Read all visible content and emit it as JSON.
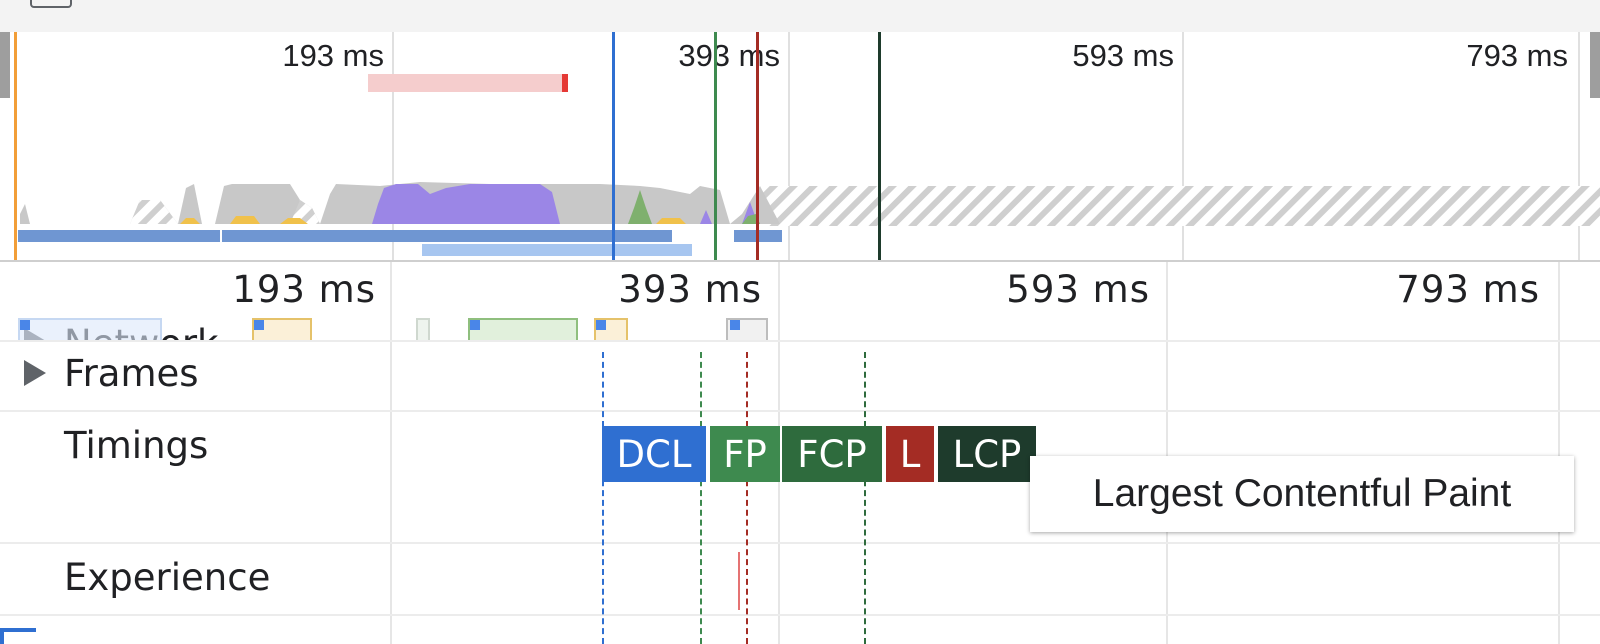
{
  "overview": {
    "ticks": [
      "193 ms",
      "393 ms",
      "593 ms",
      "793 ms"
    ]
  },
  "flamechart": {
    "ticks": [
      "193 ms",
      "393 ms",
      "593 ms",
      "793 ms"
    ],
    "tracks": {
      "network": "Network",
      "frames": "Frames",
      "timings": "Timings",
      "experience": "Experience"
    },
    "markers": {
      "dcl": "DCL",
      "fp": "FP",
      "fcp": "FCP",
      "l": "L",
      "lcp": "LCP"
    }
  },
  "tooltip": {
    "text": "Largest Contentful Paint"
  },
  "colors": {
    "dcl": "#2f6fd1",
    "fp": "#3e8a4f",
    "fcp": "#2e6b3d",
    "load": "#a42c24",
    "lcp": "#1e3b2c",
    "scripting": "#9b86e6",
    "rendering": "#c8c8c8",
    "painting": "#7fb06e",
    "loading": "#f0c14b"
  }
}
